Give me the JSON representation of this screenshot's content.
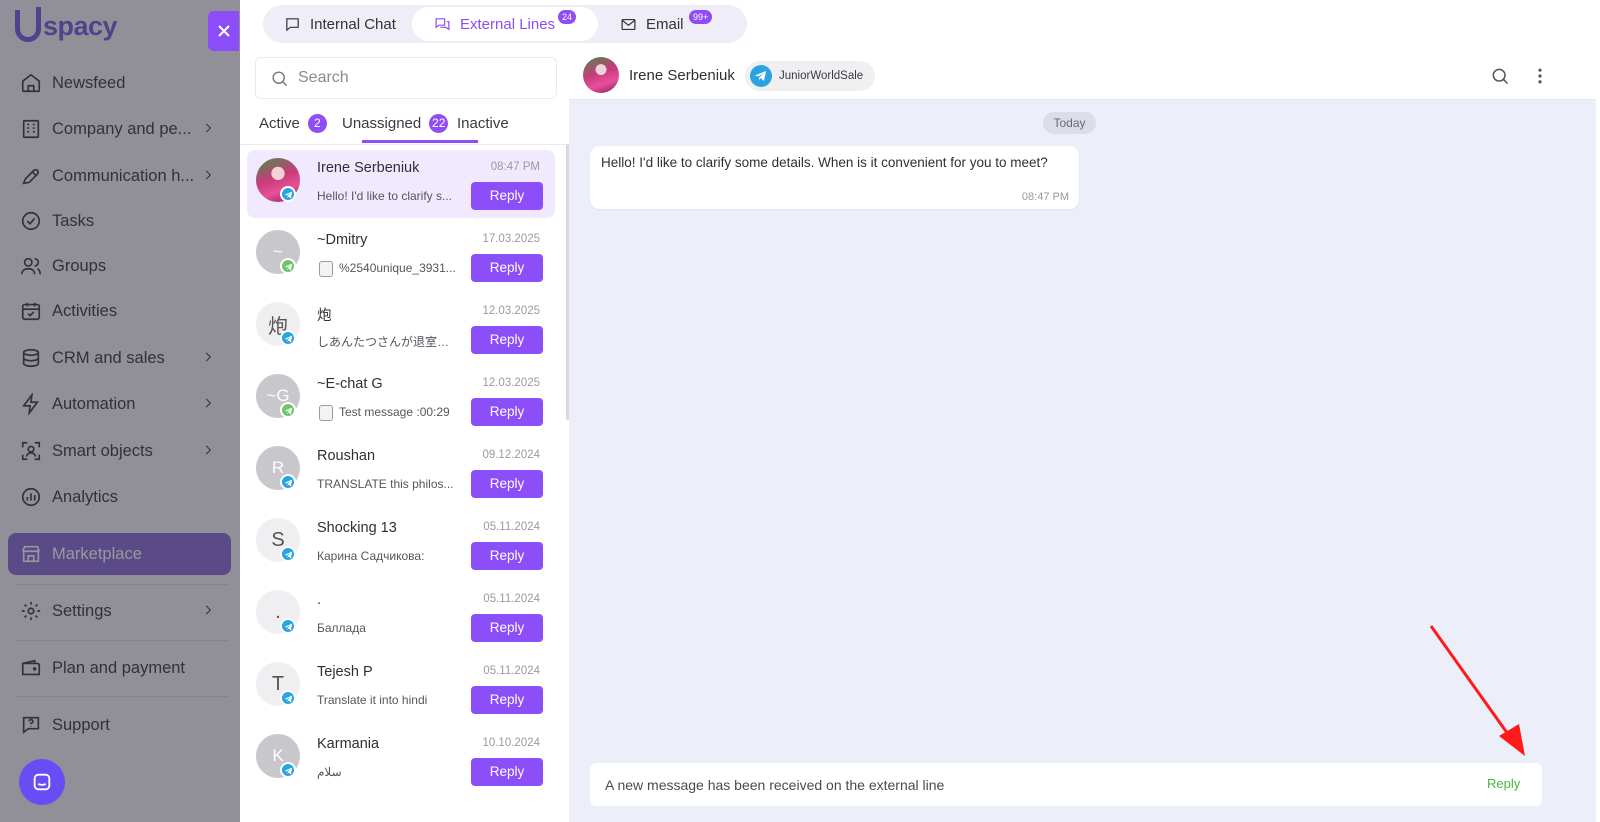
{
  "logo": {
    "text": "spacy"
  },
  "sidebar": {
    "items": [
      {
        "label": "Newsfeed",
        "icon": "home-icon"
      },
      {
        "label": "Company and pe...",
        "icon": "company-icon"
      },
      {
        "label": "Communication h...",
        "icon": "communication-icon"
      },
      {
        "label": "Tasks",
        "icon": "tasks-icon"
      },
      {
        "label": "Groups",
        "icon": "groups-icon"
      },
      {
        "label": "Activities",
        "icon": "calendar-icon"
      },
      {
        "label": "CRM and sales",
        "icon": "crm-icon"
      },
      {
        "label": "Automation",
        "icon": "lightning-icon"
      },
      {
        "label": "Smart objects",
        "icon": "smart-objects-icon"
      },
      {
        "label": "Analytics",
        "icon": "analytics-icon"
      },
      {
        "label": "Marketplace",
        "icon": "marketplace-icon"
      },
      {
        "label": "Settings",
        "icon": "gear-icon"
      },
      {
        "label": "Plan and payment",
        "icon": "wallet-icon"
      },
      {
        "label": "Support",
        "icon": "support-icon"
      }
    ]
  },
  "top_tabs": [
    {
      "label": "Internal Chat",
      "badge": ""
    },
    {
      "label": "External Lines",
      "badge": "24"
    },
    {
      "label": "Email",
      "badge": "99+"
    }
  ],
  "search": {
    "placeholder": "Search"
  },
  "sub_tabs": [
    {
      "label": "Active",
      "badge": "2"
    },
    {
      "label": "Unassigned",
      "badge": "22"
    },
    {
      "label": "Inactive",
      "badge": ""
    }
  ],
  "conversations": [
    {
      "name": "Irene Serbeniuk",
      "time": "08:47 PM",
      "preview": "Hello! I'd like to clarify s...",
      "avatar": "",
      "channel": "telegram",
      "reply": "Reply"
    },
    {
      "name": "~Dmitry",
      "time": "17.03.2025",
      "preview": "%2540unique_3931...",
      "avatar": "~",
      "channel": "whatsapp",
      "reply": "Reply"
    },
    {
      "name": "炮",
      "time": "12.03.2025",
      "preview": "しあんたつさんが退室し...",
      "avatar": "炮",
      "channel": "telegram",
      "reply": "Reply"
    },
    {
      "name": "~E-chat G",
      "time": "12.03.2025",
      "preview": "Test message :00:29",
      "avatar": "~G",
      "channel": "whatsapp",
      "reply": "Reply"
    },
    {
      "name": "Roushan",
      "time": "09.12.2024",
      "preview": "TRANSLATE this philos...",
      "avatar": "R",
      "channel": "telegram",
      "reply": "Reply"
    },
    {
      "name": "Shocking 13",
      "time": "05.11.2024",
      "preview": "Карина Садчикова:",
      "avatar": "S",
      "channel": "telegram",
      "reply": "Reply"
    },
    {
      "name": ".",
      "time": "05.11.2024",
      "preview": "Баллада",
      "avatar": ".",
      "channel": "telegram",
      "reply": "Reply"
    },
    {
      "name": "Tejesh P",
      "time": "05.11.2024",
      "preview": "Translate it into hindi",
      "avatar": "T",
      "channel": "telegram",
      "reply": "Reply"
    },
    {
      "name": "Karmania",
      "time": "10.10.2024",
      "preview": "سلام",
      "avatar": "K",
      "channel": "telegram",
      "reply": "Reply"
    }
  ],
  "chat": {
    "contact_name": "Irene Serbeniuk",
    "line_name": "JuniorWorldSale",
    "date_divider": "Today",
    "message": {
      "text": "Hello! I'd like to clarify some details. When is it convenient for you to meet?",
      "time": "08:47 PM"
    },
    "notification": {
      "text": "A new message has been received on the external line",
      "action": "Reply"
    }
  },
  "colors": {
    "accent": "#8c4ef8",
    "telegram": "#2aa3e0",
    "whatsapp": "#6fc56b",
    "annotation_arrow": "#ff1a1a",
    "notif_action": "#45b843"
  }
}
